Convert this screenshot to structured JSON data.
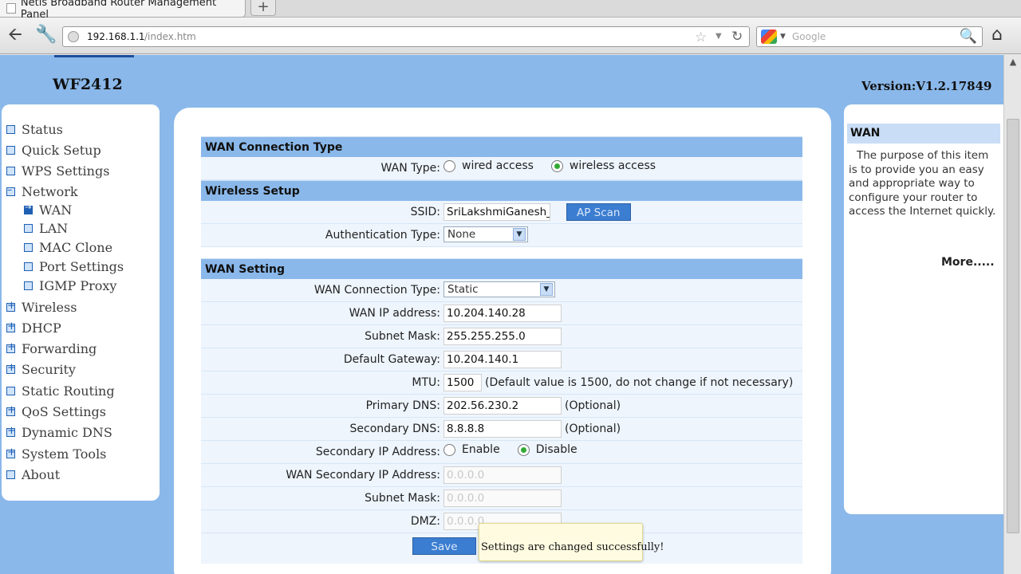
{
  "browser": {
    "tab_title": "Netis Broadband Router Management Panel",
    "new_tab": "+",
    "url_host": "192.168.1.1",
    "url_path": "/index.htm",
    "search_placeholder": "Google",
    "icons": [
      "back-arrow-icon",
      "wrench-icon",
      "site-identity-icon",
      "bookmark-star-icon",
      "reload-icon",
      "google-icon",
      "magnifier-icon",
      "home-icon"
    ]
  },
  "header": {
    "model": "WF2412",
    "version": "Version:V1.2.17849"
  },
  "sidebar": {
    "items": [
      {
        "label": "Status",
        "level": 0,
        "icon": "box"
      },
      {
        "label": "Quick Setup",
        "level": 0,
        "icon": "box"
      },
      {
        "label": "WPS Settings",
        "level": 0,
        "icon": "box"
      },
      {
        "label": "Network",
        "level": 0,
        "icon": "minus"
      },
      {
        "label": "WAN",
        "level": 1,
        "icon": "active"
      },
      {
        "label": "LAN",
        "level": 1,
        "icon": "box"
      },
      {
        "label": "MAC Clone",
        "level": 1,
        "icon": "box"
      },
      {
        "label": "Port Settings",
        "level": 1,
        "icon": "box"
      },
      {
        "label": "IGMP Proxy",
        "level": 1,
        "icon": "box"
      },
      {
        "label": "Wireless",
        "level": 0,
        "icon": "plus"
      },
      {
        "label": "DHCP",
        "level": 0,
        "icon": "plus"
      },
      {
        "label": "Forwarding",
        "level": 0,
        "icon": "plus"
      },
      {
        "label": "Security",
        "level": 0,
        "icon": "plus"
      },
      {
        "label": "Static Routing",
        "level": 0,
        "icon": "box"
      },
      {
        "label": "QoS Settings",
        "level": 0,
        "icon": "plus"
      },
      {
        "label": "Dynamic DNS",
        "level": 0,
        "icon": "plus"
      },
      {
        "label": "System Tools",
        "level": 0,
        "icon": "plus"
      },
      {
        "label": "About",
        "level": 0,
        "icon": "box"
      }
    ]
  },
  "wan_connection": {
    "section_title": "WAN Connection Type",
    "wan_type_label": "WAN Type:",
    "option_wired": "wired access",
    "option_wireless": "wireless access",
    "selected": "wireless access"
  },
  "wireless_setup": {
    "section_title": "Wireless Setup",
    "ssid_label": "SSID:",
    "ssid_value": "SriLakshmiGanesh_",
    "ap_scan_button": "AP Scan",
    "auth_label": "Authentication Type:",
    "auth_value": "None"
  },
  "wan_setting": {
    "section_title": "WAN Setting",
    "conn_type_label": "WAN Connection Type:",
    "conn_type_value": "Static",
    "ip_label": "WAN IP address:",
    "ip_value": "10.204.140.28",
    "mask_label": "Subnet Mask:",
    "mask_value": "255.255.255.0",
    "gateway_label": "Default Gateway:",
    "gateway_value": "10.204.140.1",
    "mtu_label": "MTU:",
    "mtu_value": "1500",
    "mtu_hint": "(Default value is 1500, do not change if not necessary)",
    "dns1_label": "Primary DNS:",
    "dns1_value": "202.56.230.2",
    "dns1_hint": "(Optional)",
    "dns2_label": "Secondary DNS:",
    "dns2_value": "8.8.8.8",
    "dns2_hint": "(Optional)",
    "sec_ip_label": "Secondary IP Address:",
    "sec_ip_enable": "Enable",
    "sec_ip_disable": "Disable",
    "sec_ip_selected": "Disable",
    "wan_sec_ip_label": "WAN Secondary IP Address:",
    "wan_sec_ip_value": "0.0.0.0",
    "sec_mask_label": "Subnet Mask:",
    "sec_mask_value": "0.0.0.0",
    "dmz_label": "DMZ:",
    "dmz_value": "0.0.0.0",
    "save_button": "Save"
  },
  "toast": {
    "message": "Settings are changed successfully!"
  },
  "help": {
    "title": "WAN",
    "text": "The purpose of this item is to provide you an easy and appropriate way to configure your router to access the Internet quickly.",
    "more_link": "More....."
  },
  "colors": {
    "page_bg": "#8ab8ea",
    "section_bg": "#8ab8ea",
    "row_bg": "#eef5fd",
    "button_bg": "#3b7dd0",
    "toast_bg": "#fffbe0"
  }
}
